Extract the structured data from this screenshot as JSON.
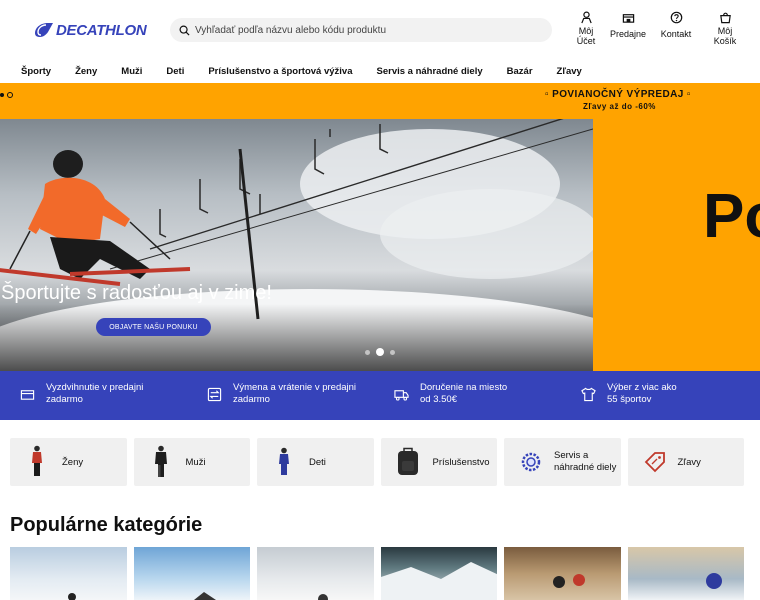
{
  "header": {
    "logo": "DECATHLON",
    "search_placeholder": "Vyhľadať podľa názvu alebo kódu produktu",
    "icons": [
      {
        "line1": "Môj",
        "line2": "Účet",
        "icon": "user-icon"
      },
      {
        "line1": "Predajne",
        "line2": "",
        "icon": "store-icon"
      },
      {
        "line1": "Kontakt",
        "line2": "",
        "icon": "help-icon"
      },
      {
        "line1": "Môj",
        "line2": "Košík",
        "icon": "cart-icon"
      }
    ]
  },
  "nav": [
    "Športy",
    "Ženy",
    "Muži",
    "Deti",
    "Príslušenstvo a športová výživa",
    "Servis a náhradné diely",
    "Bazár",
    "Zľavy"
  ],
  "promo": {
    "title": "POVIANOČNÝ VÝPREDAJ",
    "subtitle": "Zľavy až do -60%"
  },
  "hero": {
    "headline": "Športujte s radosťou aj v zime!",
    "cta": "OBJAVTE NAŠU PONUKU",
    "right_text": "Po",
    "slides": 3,
    "active_slide": 2
  },
  "benefits": [
    {
      "text1": "Vyzdvihnutie v predajni",
      "text2": "zadarmo",
      "icon": "store-pickup-icon"
    },
    {
      "text1": "Výmena a vrátenie v predajni",
      "text2": "zadarmo",
      "icon": "exchange-icon"
    },
    {
      "text1": "Doručenie na miesto",
      "text2": "od 3.50€",
      "icon": "truck-icon"
    },
    {
      "text1": "Výber z viac ako",
      "text2": "55 športov",
      "icon": "tshirt-icon"
    }
  ],
  "categories": [
    {
      "label": "Ženy",
      "label2": "",
      "icon": "woman-figure-icon"
    },
    {
      "label": "Muži",
      "label2": "",
      "icon": "man-figure-icon"
    },
    {
      "label": "Deti",
      "label2": "",
      "icon": "child-figure-icon"
    },
    {
      "label": "Príslušenstvo",
      "label2": "",
      "icon": "backpack-icon"
    },
    {
      "label": "Servis a",
      "label2": "náhradné diely",
      "icon": "gear-service-icon"
    },
    {
      "label": "Zľavy",
      "label2": "",
      "icon": "discount-tag-icon"
    }
  ],
  "popular": {
    "title": "Populárne kategórie"
  },
  "colors": {
    "brand_blue": "#3643ba",
    "promo_orange": "#ffa300"
  }
}
